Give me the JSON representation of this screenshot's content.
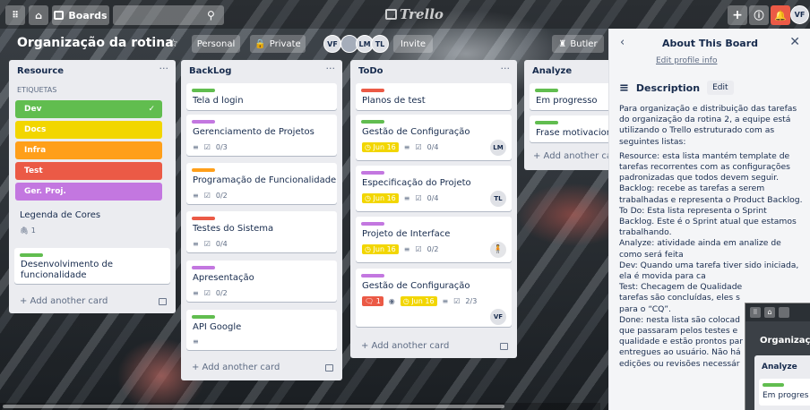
{
  "header": {
    "boards_label": "Boards",
    "logo_text": "Trello",
    "user_initials": "VF"
  },
  "board": {
    "title": "Organização da rotina",
    "visibility_team": "Personal",
    "visibility_private": "Private",
    "members": [
      "VF",
      "",
      "LM",
      "TL"
    ],
    "invite_label": "Invite",
    "butler_label": "Butler"
  },
  "lists": {
    "resource": {
      "title": "Resource",
      "section_label": "ETIQUETAS",
      "labels": [
        {
          "text": "Dev",
          "color": "#61bd4f"
        },
        {
          "text": "Docs",
          "color": "#f2d600"
        },
        {
          "text": "Infra",
          "color": "#ff9f1a"
        },
        {
          "text": "Test",
          "color": "#eb5a46"
        },
        {
          "text": "Ger. Proj.",
          "color": "#c377e0"
        }
      ],
      "legend_title": "Legenda de Cores",
      "legend_attachments": "1",
      "card2_title": "Desenvolvimento de funcionalidade",
      "add_card": "+ Add another card"
    },
    "backlog": {
      "title": "BackLog",
      "cards": [
        {
          "title": "Tela d login",
          "label": "#61bd4f"
        },
        {
          "title": "Gerenciamento de Projetos",
          "label": "#c377e0",
          "check": "0/3"
        },
        {
          "title": "Programação de Funcionalidade",
          "label": "#ff9f1a",
          "check": "0/2"
        },
        {
          "title": "Testes do Sistema",
          "label": "#eb5a46",
          "check": "0/4"
        },
        {
          "title": "Apresentação",
          "label": "#c377e0",
          "check": "0/2"
        },
        {
          "title": "API Google",
          "label": "#61bd4f"
        }
      ],
      "add_card": "+ Add another card"
    },
    "todo": {
      "title": "ToDo",
      "cards": [
        {
          "title": "Planos de test",
          "label": "#eb5a46"
        },
        {
          "title": "Gestão de Configuração",
          "label": "#61bd4f",
          "due": "Jun 16",
          "check": "0/4",
          "member": "LM"
        },
        {
          "title": "Especificação do Projeto",
          "label": "#c377e0",
          "due": "Jun 16",
          "check": "0/4",
          "member": "TL"
        },
        {
          "title": "Projeto de Interface",
          "label": "#c377e0",
          "due": "Jun 16",
          "check": "0/2"
        },
        {
          "title": "Gestão de Configuração",
          "label": "#c377e0",
          "comments": "1",
          "due": "Jun 16",
          "check": "2/3",
          "member": "VF"
        }
      ],
      "add_card": "+ Add another card"
    },
    "analyze": {
      "title": "Analyze",
      "cards": [
        {
          "title": "Em progresso",
          "label": "#61bd4f"
        },
        {
          "title": "Frase motivacional",
          "label": "#61bd4f"
        }
      ],
      "add_card": "+ Add another card"
    }
  },
  "panel": {
    "title": "About This Board",
    "edit_profile": "Edit profile info",
    "description_heading": "Description",
    "edit_button": "Edit",
    "paragraphs": [
      "Para organização e distribuição das tarefas do organização da rotina 2, a equipe está utilizando o Trello estruturado com as seguintes listas:",
      "Resource: esta lista mantém template de tarefas recorrentes com as configurações padronizadas que todos devem seguir.",
      "Backlog: recebe as tarefas a serem trabalhadas e representa o Product Backlog.",
      "To Do: Esta lista representa o Sprint Backlog. Este é o Sprint atual que estamos trabalhando.",
      "Analyze: atividade ainda em analize de como será feita",
      "Dev: Quando uma tarefa tiver sido iniciada, ela é movida para ca",
      "Test: Checagem de Qualidade",
      "tarefas são concluídas, eles s",
      "para o “CQ”.",
      "Done: nesta lista são colocad",
      "que passaram pelos testes e",
      "qualidade e estão prontos par",
      "entregues ao usuário. Não há",
      "edições ou revisões necessár"
    ]
  },
  "inset": {
    "board_title": "Organizaç",
    "list_title": "Analyze",
    "card_title": "Em progres"
  }
}
